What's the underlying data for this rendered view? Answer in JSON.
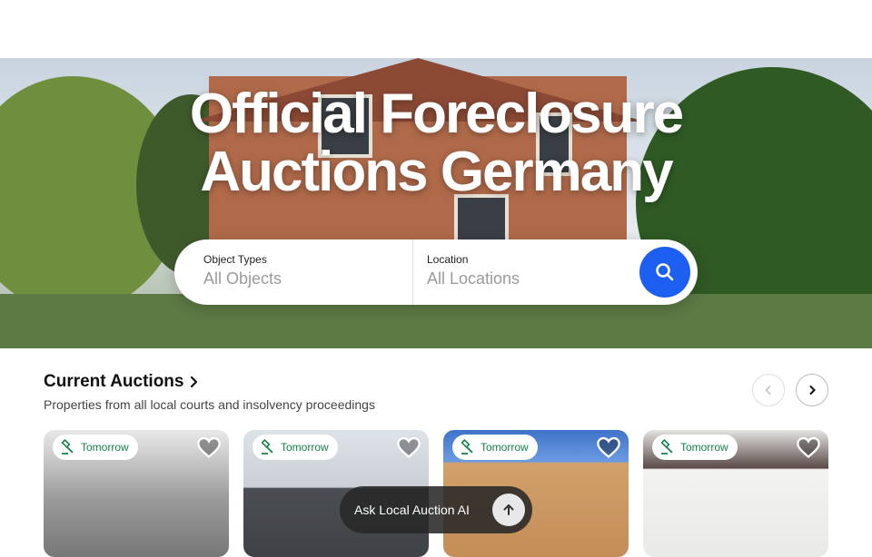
{
  "hero": {
    "title_line1": "Official Foreclosure",
    "title_line2": "Auctions Germany"
  },
  "search": {
    "object_types_label": "Object Types",
    "object_types_value": "All Objects",
    "location_label": "Location",
    "location_value": "All Locations",
    "button_icon": "search-icon"
  },
  "section": {
    "title": "Current Auctions",
    "subtitle": "Properties from all local courts and insolvency proceedings"
  },
  "cards": [
    {
      "badge": "Tomorrow",
      "badge_icon": "gavel-icon"
    },
    {
      "badge": "Tomorrow",
      "badge_icon": "gavel-icon"
    },
    {
      "badge": "Tomorrow",
      "badge_icon": "gavel-icon"
    },
    {
      "badge": "Tomorrow",
      "badge_icon": "gavel-icon"
    }
  ],
  "ai": {
    "label": "Ask Local Auction AI"
  },
  "colors": {
    "accent": "#1d5ff0",
    "badge_green": "#14804a"
  }
}
